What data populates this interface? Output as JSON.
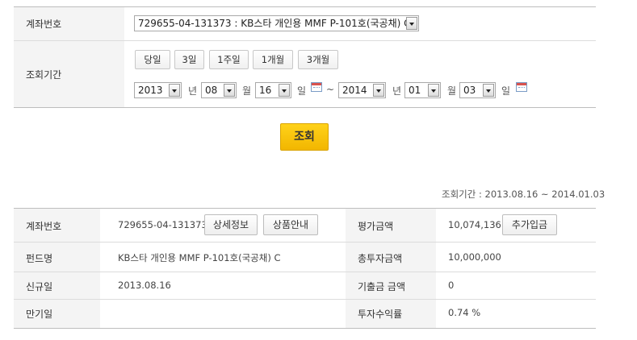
{
  "search_form": {
    "account_label": "계좌번호",
    "account_value": "729655-04-131373 : KB스타 개인용 MMF P-101호(국공채) C",
    "period_label": "조회기간",
    "quick_buttons": [
      "당일",
      "3일",
      "1주일",
      "1개월",
      "3개월"
    ],
    "from": {
      "year": "2013",
      "month": "08",
      "day": "16"
    },
    "to": {
      "year": "2014",
      "month": "01",
      "day": "03"
    },
    "unit_year": "년",
    "unit_month": "월",
    "unit_day": "일",
    "tilde": "~",
    "submit_label": "조회"
  },
  "result": {
    "period_text": "조회기간 : 2013.08.16 ~ 2014.01.03",
    "account_label": "계좌번호",
    "account_value": "729655-04-131373",
    "detail_button": "상세정보",
    "product_button": "상품안내",
    "eval_label": "평가금액",
    "eval_value": "10,074,136",
    "deposit_button": "추가입금",
    "fund_label": "펀드명",
    "fund_value": "KB스타 개인용 MMF P-101호(국공채) C",
    "total_invest_label": "총투자금액",
    "total_invest_value": "10,000,000",
    "new_date_label": "신규일",
    "new_date_value": "2013.08.16",
    "withdraw_label": "기출금 금액",
    "withdraw_value": "0",
    "maturity_label": "만기일",
    "maturity_value": "",
    "return_label": "투자수익률",
    "return_value": "0.74 %"
  }
}
